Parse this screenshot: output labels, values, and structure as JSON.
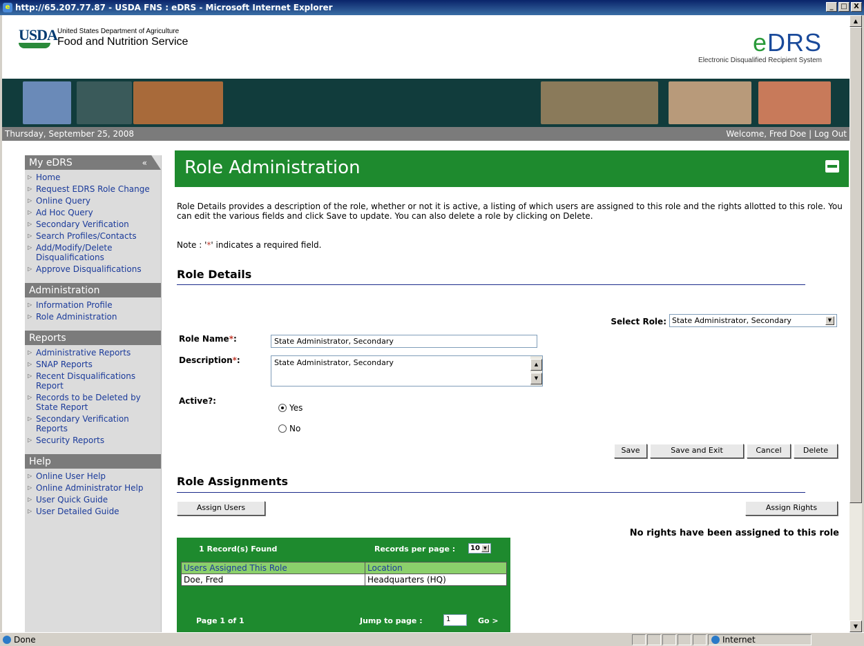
{
  "window": {
    "title": "http://65.207.77.87 - USDA FNS : eDRS - Microsoft Internet Explorer",
    "min": "_",
    "max": "□",
    "close": "X"
  },
  "header": {
    "usda": "USDA",
    "dept": "United States Department of Agriculture",
    "agency": "Food and Nutrition Service",
    "edrs_e": "e",
    "edrs_rest": "DRS",
    "edrs_sub": "Electronic Disqualified Recipient System"
  },
  "datebar": {
    "date": "Thursday, September 25, 2008",
    "welcome": "Welcome, Fred Doe",
    "sep": " | ",
    "logout": "Log Out"
  },
  "sidebar": {
    "my_head": "My eDRS",
    "collapse": "«",
    "my_items": [
      "Home",
      "Request EDRS Role Change",
      "Online Query",
      "Ad Hoc Query",
      "Secondary Verification",
      "Search Profiles/Contacts",
      "Add/Modify/Delete Disqualifications",
      "Approve Disqualifications"
    ],
    "admin_head": "Administration",
    "admin_items": [
      "Information Profile",
      "Role Administration"
    ],
    "reports_head": "Reports",
    "reports_items": [
      "Administrative Reports",
      "SNAP Reports",
      "Recent Disqualifications Report",
      "Records to be Deleted by State Report",
      "Secondary Verification Reports",
      "Security Reports"
    ],
    "help_head": "Help",
    "help_items": [
      "Online User Help",
      "Online Administrator Help",
      "User Quick Guide",
      "User Detailed Guide"
    ]
  },
  "main": {
    "title": "Role Administration",
    "intro": "Role Details provides a description of the role, whether or not it is active, a listing of which users are assigned to this role and the rights allotted to this role. You can edit the various fields and click Save to update. You can also delete a role by clicking on Delete.",
    "note_pre": "Note : '",
    "note_star": "*",
    "note_post": "' indicates a required field.",
    "details_title": "Role Details",
    "select_role_label": "Select Role:",
    "select_role_value": "State Administrator, Secondary",
    "role_name_label": "Role Name",
    "role_name_value": "State Administrator, Secondary",
    "desc_label": "Description",
    "desc_value": "State Administrator, Secondary",
    "req_mark": "*",
    "colon": ":",
    "active_label": "Active?:",
    "yes": "Yes",
    "no": "No",
    "btn_save": "Save",
    "btn_save_exit": "Save and Exit",
    "btn_cancel": "Cancel",
    "btn_delete": "Delete",
    "assign_title": "Role Assignments",
    "btn_assign_users": "Assign Users",
    "btn_assign_rights": "Assign Rights",
    "no_rights": "No rights have been assigned to this role"
  },
  "grid": {
    "found": "1 Record(s) Found",
    "per_page_label": "Records per page :",
    "per_page_value": "10",
    "columns": [
      "Users Assigned This Role",
      "Location"
    ],
    "rows": [
      [
        "Doe, Fred",
        "Headquarters (HQ)"
      ]
    ],
    "page_info": "Page 1 of 1",
    "jump_label": "Jump to page :",
    "jump_value": "1",
    "go": "Go >"
  },
  "status": {
    "done": "Done",
    "zone": "Internet"
  }
}
